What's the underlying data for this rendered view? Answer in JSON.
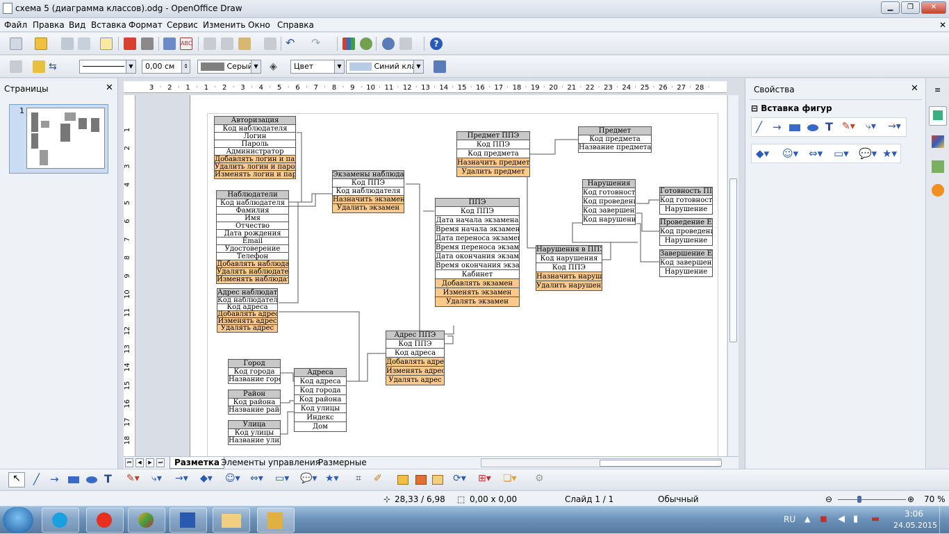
{
  "window": {
    "title": "схема 5 (диаграмма классов).odg - OpenOffice Draw"
  },
  "menu": [
    "Файл",
    "Правка",
    "Вид",
    "Вставка",
    "Формат",
    "Сервис",
    "Изменить",
    "Окно",
    "Справка"
  ],
  "line_toolbar": {
    "line_width": "0,00 см",
    "area_color": "Серый",
    "fill_type": "Цвет",
    "fill_value": "Синий кла"
  },
  "pages_panel": {
    "title": "Страницы",
    "page_number": "1"
  },
  "sheet_tabs": [
    "Разметка",
    "Элементы управления",
    "Размерные"
  ],
  "properties": {
    "title": "Свойства",
    "section": "Вставка фигур"
  },
  "status": {
    "position": "28,33 / 6,98",
    "size": "0,00 x 0,00",
    "slide": "Слайд 1 / 1",
    "style": "Обычный",
    "zoom": "70 %"
  },
  "taskbar": {
    "lang": "RU",
    "time": "3:06",
    "date": "24.05.2015"
  },
  "ruler_h": [
    "3",
    "2",
    "1",
    "1",
    "2",
    "3",
    "4",
    "5",
    "6",
    "7",
    "8",
    "9",
    "10",
    "11",
    "12",
    "13",
    "14",
    "15",
    "16",
    "17",
    "18",
    "19",
    "20",
    "21",
    "22",
    "23",
    "24",
    "25",
    "26",
    "27",
    "28"
  ],
  "ruler_v": [
    "1",
    "2",
    "3",
    "4",
    "5",
    "6",
    "7",
    "8",
    "9",
    "10",
    "11",
    "12",
    "13",
    "14",
    "15",
    "16",
    "17",
    "18"
  ],
  "entities": [
    {
      "title": "Авторизация",
      "rows": [
        "Код наблюдателя",
        "Логин",
        "Пароль",
        "Администратор"
      ],
      "ops": [
        "Добавлять логин и пароль",
        "Удалить логин и пароль",
        "Изменять логин и пароль"
      ]
    },
    {
      "title": "Наблюдатели",
      "rows": [
        "Код наблюдателя",
        "Фамилия",
        "Имя",
        "Отчество",
        "Дата рождения",
        "Email",
        "Удостоверение",
        "Телефон"
      ],
      "ops": [
        "Добавлять наблюдателя",
        "Удалять наблюдателя",
        "Изменять наблюдателя"
      ]
    },
    {
      "title": "Адрес наблюдателя",
      "rows": [
        "Код наблюдателя",
        "Код адреса"
      ],
      "ops": [
        "Добавлять адрес",
        "Изменять адрес",
        "Удалять адрес"
      ]
    },
    {
      "title": "Город",
      "rows": [
        "Код города",
        "Название города"
      ],
      "ops": []
    },
    {
      "title": "Район",
      "rows": [
        "Код района",
        "Название района"
      ],
      "ops": []
    },
    {
      "title": "Улица",
      "rows": [
        "Код улицы",
        "Название улицы"
      ],
      "ops": []
    },
    {
      "title": "Адреса",
      "rows": [
        "Код адреса",
        "Код города",
        "Код района",
        "Код улицы",
        "Индекс",
        "Дом"
      ],
      "ops": []
    },
    {
      "title": "Экзамены наблюдателя",
      "rows": [
        "Код ППЭ",
        "Код наблюдателя"
      ],
      "ops": [
        "Назначить экзамен",
        "Удалить экзамен"
      ]
    },
    {
      "title": "Предмет ППЭ",
      "rows": [
        "Код ППЭ",
        "Код предмета"
      ],
      "ops": [
        "Назначить предмет",
        "Удалить предмет"
      ]
    },
    {
      "title": "Предмет",
      "rows": [
        "Код предмета",
        "Название предмета"
      ],
      "ops": []
    },
    {
      "title": "ППЭ",
      "rows": [
        "Код ППЭ",
        "Дата начала экзамена",
        "Время начала экзамена",
        "Дата переноса экзамена",
        "Время переноса экзамена",
        "Дата окончания экзамена",
        "Время окончания экзамена",
        "Кабинет"
      ],
      "ops": [
        "Добавлять экзамен",
        "Изменять экзамен",
        "Удалять экзамен"
      ]
    },
    {
      "title": "Адрес ППЭ",
      "rows": [
        "Код ППЭ",
        "Код адреса"
      ],
      "ops": [
        "Добавлять адрес",
        "Изменять адрес",
        "Удалять адрес"
      ]
    },
    {
      "title": "Нарушения",
      "rows": [
        "Код готовности",
        "Код проведения",
        "Код завершения",
        "Код нарушения"
      ],
      "ops": []
    },
    {
      "title": "Нарушения в ППЭ",
      "rows": [
        "Код нарушения",
        "Код ППЭ"
      ],
      "ops": [
        "Назначить нарушение",
        "Удалить нарушение"
      ]
    },
    {
      "title": "Готовность ППЭ",
      "rows": [
        "Код готовности",
        "Нарушение"
      ],
      "ops": []
    },
    {
      "title": "Проведение ЕГЭ",
      "rows": [
        "Код проведения",
        "Нарушение"
      ],
      "ops": []
    },
    {
      "title": "Завершение ЕГЭ",
      "rows": [
        "Код завершения",
        "Нарушение"
      ],
      "ops": []
    }
  ]
}
